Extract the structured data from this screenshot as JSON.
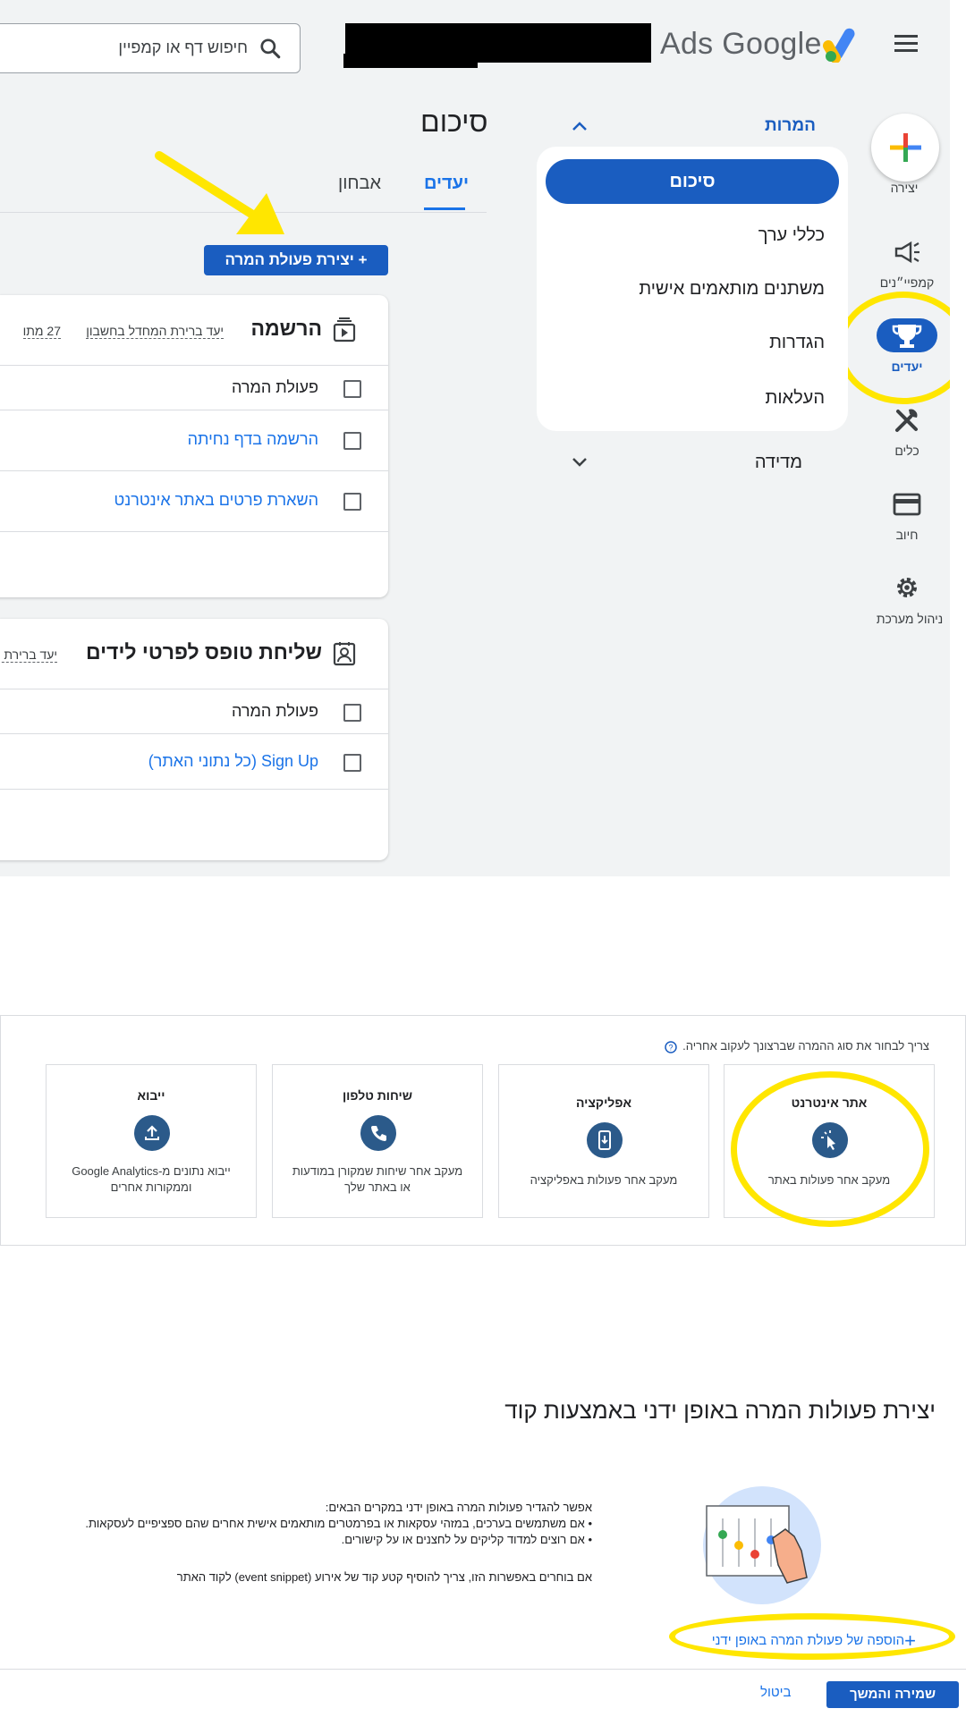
{
  "header": {
    "search_placeholder": "חיפוש דף או קמפיין",
    "brand": "Ads Google"
  },
  "rail": {
    "create_label": "יצירה",
    "campaigns_label": "קמפיי״נים",
    "goals_label": "יעדים",
    "tools_label": "כלים",
    "billing_label": "חיוב",
    "admin_label": "ניהול מערכת"
  },
  "nav": {
    "section_conversions": "המרות",
    "items": [
      "סיכום",
      "כללי ערך",
      "משתנים מותאמים אישית",
      "הגדרות",
      "העלאות"
    ],
    "section_measurement": "מדידה"
  },
  "content": {
    "page_title": "סיכום",
    "tabs": [
      "יעדים",
      "אבחון"
    ],
    "create_button": "+ יצירת פעולת המרה",
    "card1": {
      "title": "הרשמה",
      "subtitle": "יעד ברירת המחדל בחשבון",
      "count": "27 מתו",
      "header_row": "פעולת המרה",
      "rows": [
        "הרשמה בדף נחיתה",
        "השארת פרטים באתר אינטרנט"
      ]
    },
    "card2": {
      "title": "שליחת טופס לפרטי לידים",
      "subtitle": "יעד ברירת ה",
      "header_row": "פעולת המרה",
      "rows": [
        "Sign Up (כל נתוני האתר)"
      ]
    }
  },
  "conversion_types": {
    "hint": "צריך לבחור את סוג ההמרה שברצונך לעקוב אחריה.",
    "options": [
      {
        "title": "אתר אינטרנט",
        "desc": "מעקב אחר פעולות באתר",
        "icon": "website-cursor-icon"
      },
      {
        "title": "אפליקציה",
        "desc": "מעקב אחר פעולות באפליקציה",
        "icon": "phone-app-icon"
      },
      {
        "title": "שיחות טלפון",
        "desc": "מעקב אחר שיחות שמקורן במודעות או באתר שלך",
        "icon": "phone-call-icon"
      },
      {
        "title": "ייבוא",
        "desc": "ייבוא נתונים מ-Google Analytics וממקורות אחרים",
        "icon": "upload-icon"
      }
    ]
  },
  "manual": {
    "title": "יצירת פעולות המרה באופן ידני באמצעות קוד",
    "intro": "אפשר להגדיר פעולות המרה באופן ידני במקרים הבאים:",
    "bullets": [
      "אם משתמשים בערכים, במזהי עסקאות או בפרמטרים מותאמים אישית אחרים שהם ספציפיים לעסקאות.",
      "אם רוצים למדוד קליקים על לחצנים או על קישורים."
    ],
    "note": "אם בוחרים באפשרות הזו, צריך להוסיף קטע קוד של אירוע (event snippet) לקוד האתר",
    "add_link": "הוספה של פעולת המרה באופן ידני"
  },
  "footer": {
    "save": "שמירה והמשך",
    "cancel": "ביטול"
  },
  "colors": {
    "primary": "#1a5dc0",
    "link": "#1a73e8",
    "highlight": "#ffe600"
  }
}
